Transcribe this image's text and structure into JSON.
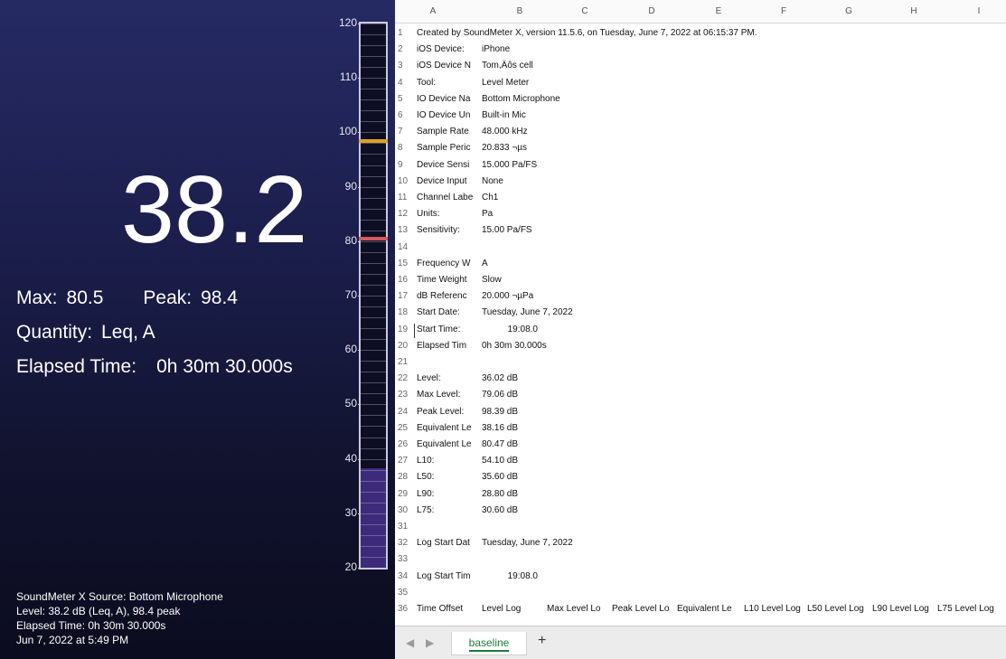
{
  "meter": {
    "value": "38.2",
    "max_label": "Max:",
    "max_value": "80.5",
    "peak_label": "Peak:",
    "peak_value": "98.4",
    "quantity_label": "Quantity:",
    "quantity_value": "Leq, A",
    "elapsed_label": "Elapsed Time:",
    "elapsed_value": "0h 30m 30.000s",
    "scale_ticks": [
      "120",
      "110",
      "100",
      "90",
      "80",
      "70",
      "60",
      "50",
      "40",
      "30",
      "20"
    ],
    "level_fill_db": 38.2,
    "max_marker_db": 80.5,
    "peak_marker_db": 98.4,
    "scale_min_db": 20,
    "scale_max_db": 120,
    "colors": {
      "fill": "#3d2a7a",
      "max_marker": "#d45a5a",
      "peak_marker": "#e0a020"
    },
    "source_lines": [
      "SoundMeter X Source: Bottom Microphone",
      "Level: 38.2 dB (Leq, A), 98.4 peak",
      "Elapsed Time:  0h 30m 30.000s",
      "Jun 7, 2022 at 5:49 PM"
    ]
  },
  "sheet": {
    "columns": [
      "A",
      "B",
      "C",
      "D",
      "E",
      "F",
      "G",
      "H",
      "I"
    ],
    "rows": [
      {
        "n": "1",
        "wide": "Created by SoundMeter X, version 11.5.6, on Tuesday, June 7, 2022 at 06:15:37 PM."
      },
      {
        "n": "2",
        "a": "iOS Device:",
        "b": "iPhone"
      },
      {
        "n": "3",
        "a": "iOS Device N",
        "b": "Tom,Äôs cell"
      },
      {
        "n": "4",
        "a": "Tool:",
        "b": "Level Meter"
      },
      {
        "n": "5",
        "a": "IO Device Na",
        "b": "Bottom Microphone"
      },
      {
        "n": "6",
        "a": "IO Device Un",
        "b": "Built-in Mic"
      },
      {
        "n": "7",
        "a": "Sample Rate",
        "b": "48.000 kHz"
      },
      {
        "n": "8",
        "a": "Sample Peric",
        "b": "20.833 ¬µs"
      },
      {
        "n": "9",
        "a": "Device Sensi",
        "b": "15.000 Pa/FS"
      },
      {
        "n": "10",
        "a": "Device Input",
        "b": "None"
      },
      {
        "n": "11",
        "a": "Channel Labe",
        "b": "Ch1"
      },
      {
        "n": "12",
        "a": "Units:",
        "b": "Pa"
      },
      {
        "n": "13",
        "a": "Sensitivity:",
        "b": "15.00 Pa/FS"
      },
      {
        "n": "14"
      },
      {
        "n": "15",
        "a": "Frequency W",
        "b": "A"
      },
      {
        "n": "16",
        "a": "Time Weight",
        "b": "Slow"
      },
      {
        "n": "17",
        "a": "dB Referenc",
        "b": "20.000 ¬µPa"
      },
      {
        "n": "18",
        "a": "Start Date:",
        "b": "Tuesday, June 7, 2022"
      },
      {
        "n": "19",
        "a": "Start Time:",
        "b_right": "19:08.0"
      },
      {
        "n": "20",
        "a": "Elapsed Tim",
        "b": "0h 30m 30.000s"
      },
      {
        "n": "21"
      },
      {
        "n": "22",
        "a": "Level:",
        "b": "36.02 dB"
      },
      {
        "n": "23",
        "a": "Max Level:",
        "b": "79.06 dB"
      },
      {
        "n": "24",
        "a": "Peak Level:",
        "b": "98.39 dB"
      },
      {
        "n": "25",
        "a": "Equivalent Le",
        "b": "38.16 dB"
      },
      {
        "n": "26",
        "a": "Equivalent Le",
        "b": "80.47 dB"
      },
      {
        "n": "27",
        "a": "L10:",
        "b": "54.10 dB"
      },
      {
        "n": "28",
        "a": "L50:",
        "b": "35.60 dB"
      },
      {
        "n": "29",
        "a": "L90:",
        "b": "28.80 dB"
      },
      {
        "n": "30",
        "a": "L75:",
        "b": "30.60 dB"
      },
      {
        "n": "31"
      },
      {
        "n": "32",
        "a": "Log Start Dat",
        "b": "Tuesday, June 7, 2022"
      },
      {
        "n": "33"
      },
      {
        "n": "34",
        "a": "Log Start Tim",
        "b_right": "19:08.0"
      },
      {
        "n": "35"
      },
      {
        "n": "36",
        "headers": [
          "Time Offset",
          "Level Log",
          "Max Level Lo",
          "Peak Level Lo",
          "Equivalent Le",
          "L10 Level Log",
          "L50 Level Log",
          "L90 Level Log",
          "L75 Level Log"
        ]
      }
    ],
    "tab_name": "baseline",
    "add_sheet": "+",
    "nav_prev": "◀",
    "nav_next": "▶"
  }
}
